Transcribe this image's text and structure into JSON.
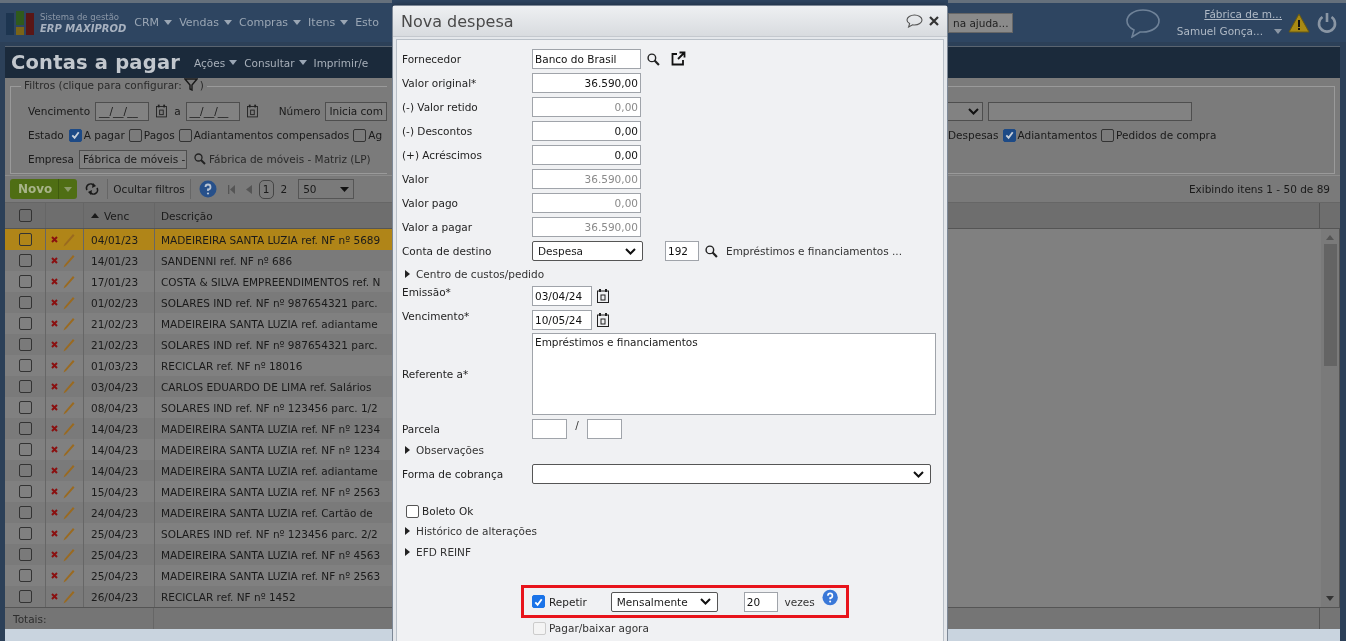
{
  "app": {
    "logo": {
      "line1": "Sistema de gestão",
      "line2": "ERP MAXIPROD"
    },
    "menu": [
      {
        "label": "CRM",
        "has_caret": true
      },
      {
        "label": "Vendas",
        "has_caret": true
      },
      {
        "label": "Compras",
        "has_caret": true
      },
      {
        "label": "Itens",
        "has_caret": true
      },
      {
        "label": "Esto",
        "has_caret": false
      }
    ],
    "help_button": "na ajuda...",
    "company_link": "Fábrica de m...",
    "user": "Samuel Gonça..."
  },
  "page": {
    "title": "Contas a pagar",
    "actions": [
      {
        "label": "Ações",
        "has_caret": true
      },
      {
        "label": "Consultar",
        "has_caret": true
      },
      {
        "label": "Imprimir/e",
        "has_caret": false
      }
    ]
  },
  "filters": {
    "legend": "Filtros (clique para configurar:",
    "legend_end": ")",
    "due_label": "Vencimento",
    "date_from": "__/__/__",
    "between": "a",
    "date_to": "__/__/__",
    "number_label": "Número",
    "number_mode": "Inicia com",
    "state_label": "Estado",
    "state_options": [
      {
        "label": "A pagar",
        "checked": true
      },
      {
        "label": "Pagos",
        "checked": false
      },
      {
        "label": "Adiantamentos compensados",
        "checked": false
      },
      {
        "label": "Ag",
        "checked": false
      }
    ],
    "type_options": [
      {
        "label": "Despesas"
      },
      {
        "label": "Adiantamentos",
        "checked": true
      },
      {
        "label": "Pedidos de compra",
        "checked": false
      }
    ],
    "company_label": "Empresa",
    "company_value": "Fábrica de móveis -",
    "company_name": "Fábrica de móveis - Matriz (LP)"
  },
  "toolbar": {
    "new_button": "Novo",
    "hide_filters": "Ocultar filtros",
    "pages": [
      {
        "label": "1",
        "selected": true
      },
      {
        "label": "2",
        "selected": false
      }
    ],
    "page_size": "50",
    "summary": "Exibindo itens 1 - 50 de 89"
  },
  "table": {
    "header_checked": false,
    "columns": [
      "Venc",
      "Descrição"
    ],
    "totals_label": "Totais:",
    "rows": [
      {
        "venc": "04/01/23",
        "description": "MADEIREIRA SANTA LUZIA ref. NF nº 5689",
        "selected": true,
        "checked": false
      },
      {
        "venc": "14/01/23",
        "description": "SANDENNI ref. NF nº 686",
        "selected": false,
        "checked": false
      },
      {
        "venc": "17/01/23",
        "description": "COSTA & SILVA EMPREENDIMENTOS ref. N",
        "selected": false,
        "checked": false
      },
      {
        "venc": "01/02/23",
        "description": "SOLARES IND ref. NF nº 987654321 parc.",
        "selected": false,
        "checked": false
      },
      {
        "venc": "21/02/23",
        "description": "MADEIREIRA SANTA LUZIA ref. adiantame",
        "selected": false,
        "checked": false
      },
      {
        "venc": "21/02/23",
        "description": "SOLARES IND ref. NF nº 987654321 parc.",
        "selected": false,
        "checked": false
      },
      {
        "venc": "01/03/23",
        "description": "RECICLAR ref. NF nº 18016",
        "selected": false,
        "checked": false
      },
      {
        "venc": "03/04/23",
        "description": "CARLOS EDUARDO DE LIMA ref. Salários",
        "selected": false,
        "checked": false
      },
      {
        "venc": "08/04/23",
        "description": "SOLARES IND ref. NF nº 123456 parc. 1/2",
        "selected": false,
        "checked": false
      },
      {
        "venc": "14/04/23",
        "description": "MADEIREIRA SANTA LUZIA ref. NF nº 1234",
        "selected": false,
        "checked": false
      },
      {
        "venc": "14/04/23",
        "description": "MADEIREIRA SANTA LUZIA ref. NF nº 1234",
        "selected": false,
        "checked": false
      },
      {
        "venc": "14/04/23",
        "description": "MADEIREIRA SANTA LUZIA ref. adiantame",
        "selected": false,
        "checked": false
      },
      {
        "venc": "15/04/23",
        "description": "MADEIREIRA SANTA LUZIA ref. NF nº 2563",
        "selected": false,
        "checked": false
      },
      {
        "venc": "24/04/23",
        "description": "MADEIREIRA SANTA LUZIA ref. Cartão de",
        "selected": false,
        "checked": false
      },
      {
        "venc": "25/04/23",
        "description": "SOLARES IND ref. NF nº 123456 parc. 2/2",
        "selected": false,
        "checked": false
      },
      {
        "venc": "25/04/23",
        "description": "MADEIREIRA SANTA LUZIA ref. NF nº 4563",
        "selected": false,
        "checked": false
      },
      {
        "venc": "25/04/23",
        "description": "MADEIREIRA SANTA LUZIA ref. NF nº 2563",
        "selected": false,
        "checked": false
      },
      {
        "venc": "26/04/23",
        "description": "RECICLAR ref. NF nº 1452",
        "selected": false,
        "checked": false
      }
    ]
  },
  "dialog": {
    "title": "Nova despesa",
    "fields": [
      {
        "kind": "supplier",
        "label": "Fornecedor",
        "value": "Banco do Brasil"
      },
      {
        "kind": "amount",
        "label": "Valor original*",
        "value": "36.590,00",
        "disabled": false
      },
      {
        "kind": "amount",
        "label": "(-) Valor retido",
        "value": "0,00",
        "disabled": true
      },
      {
        "kind": "amount",
        "label": "(-) Descontos",
        "value": "0,00",
        "disabled": false
      },
      {
        "kind": "amount",
        "label": "(+) Acréscimos",
        "value": "0,00",
        "disabled": false
      },
      {
        "kind": "amount",
        "label": "Valor",
        "value": "36.590,00",
        "disabled": true
      },
      {
        "kind": "amount",
        "label": "Valor pago",
        "value": "0,00",
        "disabled": true
      },
      {
        "kind": "amount",
        "label": "Valor a pagar",
        "value": "36.590,00",
        "disabled": true
      },
      {
        "kind": "account",
        "label": "Conta de destino",
        "value": "Despesa",
        "code": "192",
        "description": "Empréstimos e financiamentos ..."
      },
      {
        "kind": "expander",
        "label": "Centro de custos/pedido",
        "expanded": false
      },
      {
        "kind": "date",
        "label": "Emissão*",
        "value": "03/04/24"
      },
      {
        "kind": "date",
        "label": "Vencimento*",
        "value": "10/05/24"
      },
      {
        "kind": "textarea",
        "label": "Referente a*",
        "value": "Empréstimos e financiamentos"
      },
      {
        "kind": "installment",
        "label": "Parcela",
        "separator": "/"
      },
      {
        "kind": "expander",
        "label": "Observações",
        "expanded": false
      },
      {
        "kind": "select",
        "label": "Forma de cobrança"
      },
      {
        "kind": "checkbox",
        "label": "Boleto Ok",
        "checked": false
      },
      {
        "kind": "expander",
        "label": "Histórico de alterações",
        "expanded": false
      },
      {
        "kind": "expander",
        "label": "EFD REINF",
        "expanded": false
      }
    ],
    "repeat": {
      "highlighted": true,
      "checked": true,
      "label": "Repetir",
      "frequency": "Mensalmente",
      "times": "20",
      "times_label": "vezes"
    },
    "pay_now": {
      "label": "Pagar/baixar agora",
      "checked": false,
      "disabled": true
    }
  }
}
